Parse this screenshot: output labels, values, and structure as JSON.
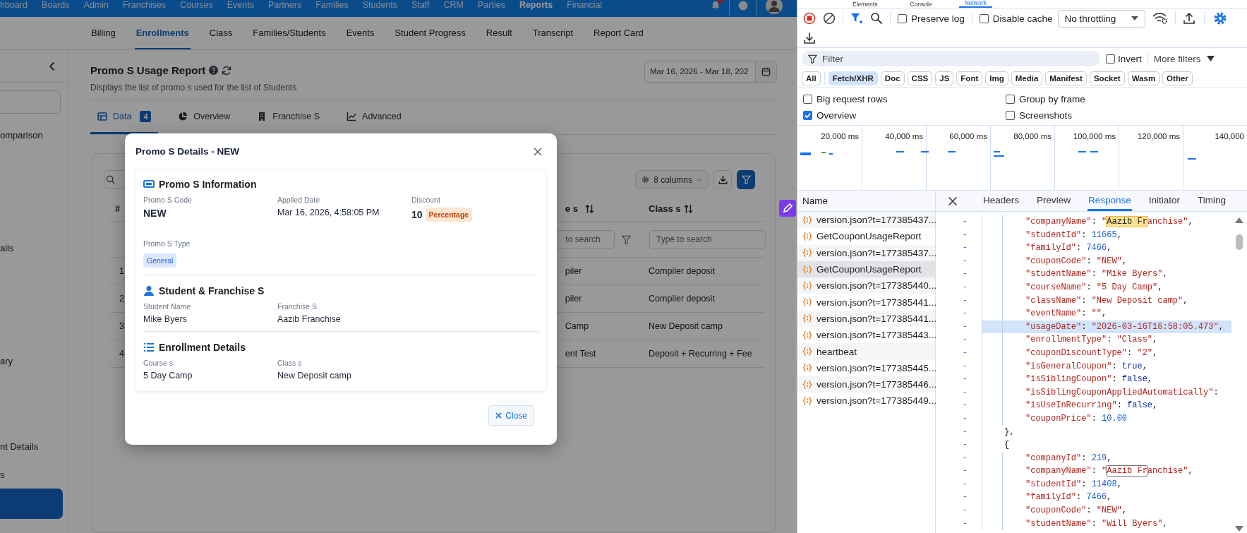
{
  "app": {
    "top_nav": [
      {
        "label": "hboard",
        "selected": false
      },
      {
        "label": "Boards",
        "selected": false
      },
      {
        "label": "Admin",
        "selected": false
      },
      {
        "label": "Franchises",
        "selected": false
      },
      {
        "label": "Courses",
        "selected": false
      },
      {
        "label": "Events",
        "selected": false
      },
      {
        "label": "Partners",
        "selected": false
      },
      {
        "label": "Families",
        "selected": false
      },
      {
        "label": "Students",
        "selected": false
      },
      {
        "label": "Staff",
        "selected": false
      },
      {
        "label": "CRM",
        "selected": false
      },
      {
        "label": "Parties",
        "selected": false
      },
      {
        "label": "Reports",
        "selected": true
      },
      {
        "label": "Financial",
        "selected": false
      }
    ],
    "sub_nav": [
      {
        "label": "Billing",
        "selected": false
      },
      {
        "label": "Enrollments",
        "selected": true
      },
      {
        "label": "Class",
        "selected": false
      },
      {
        "label": "Families/Students",
        "selected": false
      },
      {
        "label": "Events",
        "selected": false
      },
      {
        "label": "Student Progress",
        "selected": false
      },
      {
        "label": "Result",
        "selected": false
      },
      {
        "label": "Transcript",
        "selected": false
      },
      {
        "label": "Report Card",
        "selected": false
      }
    ],
    "sidebar": {
      "items": [
        "omparison",
        "ails",
        "ary",
        "nt Details",
        "s"
      ]
    },
    "report": {
      "title": "Promo S Usage Report",
      "subtitle": "Displays the list of promo s used for the list of Students",
      "date_range": "Mar 16, 2026 - Mar 18, 202",
      "tabs": [
        {
          "label": "Data",
          "badge": "4",
          "selected": true
        },
        {
          "label": "Overview",
          "selected": false
        },
        {
          "label": "Franchise S",
          "selected": false
        },
        {
          "label": "Advanced",
          "selected": false
        }
      ],
      "columns_button": "8 columns",
      "table": {
        "columns": [
          "#",
          "e s",
          "Class s"
        ],
        "filter_placeholders": [
          "to search",
          "Type to search"
        ],
        "rows": [
          [
            "1",
            "piler",
            "Compiler deposit"
          ],
          [
            "2",
            "piler",
            "Compiler deposit"
          ],
          [
            "3",
            "Camp",
            "New Deposit camp"
          ],
          [
            "4",
            "ent Test",
            "Deposit + Recurring + Fee"
          ]
        ]
      }
    }
  },
  "modal": {
    "title": "Promo S Details - NEW",
    "sections": [
      {
        "title": "Promo S Information",
        "rows": [
          [
            {
              "label": "Promo S Code",
              "value": "NEW",
              "kind": "code"
            },
            {
              "label": "Applied Date",
              "value": "Mar 16, 2026, 4:58:05 PM",
              "kind": "text"
            },
            {
              "label": "Discount",
              "value": "10",
              "badge": "Percentage",
              "color": "#fde6d0",
              "kind": "amount"
            }
          ],
          [
            {
              "label": "Promo S Type",
              "badge": "General",
              "color": "#dbe8fd",
              "kind": "badge"
            }
          ]
        ]
      },
      {
        "title": "Student & Franchise S",
        "rows": [
          [
            {
              "label": "Student Name",
              "value": "Mike Byers",
              "kind": "text"
            },
            {
              "label": "Franchise S",
              "value": "Aazib Franchise",
              "kind": "text"
            }
          ]
        ]
      },
      {
        "title": "Enrollment Details",
        "rows": [
          [
            {
              "label": "Course s",
              "value": "5 Day Camp",
              "kind": "text"
            },
            {
              "label": "Class s",
              "value": "New Deposit camp",
              "kind": "text"
            }
          ]
        ]
      }
    ],
    "close_button": "Close"
  },
  "devtools": {
    "panel_tabs": [
      {
        "label": "Elements",
        "selected": false
      },
      {
        "label": "Console",
        "selected": false
      },
      {
        "label": "Network",
        "selected": true
      }
    ],
    "preserve_log": {
      "label": "Preserve log",
      "checked": false
    },
    "disable_cache": {
      "label": "Disable cache",
      "checked": false
    },
    "throttling": "No throttling",
    "filter": {
      "placeholder": "Filter"
    },
    "invert": {
      "label": "Invert",
      "checked": false
    },
    "more_filters": "More filters",
    "type_filters": [
      {
        "label": "All",
        "selected": false
      },
      {
        "label": "Fetch/XHR",
        "selected": true
      },
      {
        "label": "Doc",
        "selected": false
      },
      {
        "label": "CSS",
        "selected": false
      },
      {
        "label": "JS",
        "selected": false
      },
      {
        "label": "Font",
        "selected": false
      },
      {
        "label": "Img",
        "selected": false
      },
      {
        "label": "Media",
        "selected": false
      },
      {
        "label": "Manifest",
        "selected": false
      },
      {
        "label": "Socket",
        "selected": false
      },
      {
        "label": "Wasm",
        "selected": false
      },
      {
        "label": "Other",
        "selected": false
      }
    ],
    "options": [
      {
        "label": "Big request rows",
        "checked": false
      },
      {
        "label": "Group by frame",
        "checked": false
      },
      {
        "label": "Overview",
        "checked": true
      },
      {
        "label": "Screenshots",
        "checked": false
      }
    ],
    "timeline_ticks": [
      "20,000 ms",
      "40,000 ms",
      "60,000 ms",
      "80,000 ms",
      "100,000 ms",
      "120,000 ms",
      "140,000"
    ],
    "requests": {
      "column": "Name",
      "items": [
        {
          "label": "version.json?t=177385437...",
          "selected": false
        },
        {
          "label": "GetCouponUsageReport",
          "selected": false
        },
        {
          "label": "version.json?t=177385437...",
          "selected": false
        },
        {
          "label": "GetCouponUsageReport",
          "selected": true
        },
        {
          "label": "version.json?t=177385440...",
          "selected": false
        },
        {
          "label": "version.json?t=177385441...",
          "selected": false
        },
        {
          "label": "version.json?t=177385441...",
          "selected": false
        },
        {
          "label": "version.json?t=177385443...",
          "selected": false
        },
        {
          "label": "heartbeat",
          "selected": false
        },
        {
          "label": "version.json?t=177385445...",
          "selected": false
        },
        {
          "label": "version.json?t=177385446...",
          "selected": false
        },
        {
          "label": "version.json?t=177385449...",
          "selected": false
        }
      ]
    },
    "detail_tabs": [
      {
        "label": "Headers",
        "selected": false
      },
      {
        "label": "Preview",
        "selected": false
      },
      {
        "label": "Response",
        "selected": true
      },
      {
        "label": "Initiator",
        "selected": false
      },
      {
        "label": "Timing",
        "selected": false
      }
    ],
    "response_lines": [
      {
        "marker": "-",
        "kind": "pair",
        "highlighted": false,
        "parts": [
          {
            "text": "\"companyName\"",
            "kind": "key"
          },
          {
            "text": ": ",
            "kind": "punct"
          },
          {
            "text": "\"",
            "kind": "str"
          },
          {
            "text": "Aazib Fr",
            "kind": "match-current"
          },
          {
            "text": "anchise\"",
            "kind": "str"
          },
          {
            "text": ",",
            "kind": "punct"
          }
        ]
      },
      {
        "marker": "-",
        "kind": "pair",
        "highlighted": false,
        "parts": [
          {
            "text": "\"studentId\"",
            "kind": "key"
          },
          {
            "text": ": ",
            "kind": "punct"
          },
          {
            "text": "11665",
            "kind": "num"
          },
          {
            "text": ",",
            "kind": "punct"
          }
        ]
      },
      {
        "marker": "-",
        "kind": "pair",
        "highlighted": false,
        "parts": [
          {
            "text": "\"familyId\"",
            "kind": "key"
          },
          {
            "text": ": ",
            "kind": "punct"
          },
          {
            "text": "7466",
            "kind": "num"
          },
          {
            "text": ",",
            "kind": "punct"
          }
        ]
      },
      {
        "marker": "-",
        "kind": "pair",
        "highlighted": false,
        "parts": [
          {
            "text": "\"couponCode\"",
            "kind": "key"
          },
          {
            "text": ": ",
            "kind": "punct"
          },
          {
            "text": "\"NEW\"",
            "kind": "str"
          },
          {
            "text": ",",
            "kind": "punct"
          }
        ]
      },
      {
        "marker": "-",
        "kind": "pair",
        "highlighted": false,
        "parts": [
          {
            "text": "\"studentName\"",
            "kind": "key"
          },
          {
            "text": ": ",
            "kind": "punct"
          },
          {
            "text": "\"Mike Byers\"",
            "kind": "str"
          },
          {
            "text": ",",
            "kind": "punct"
          }
        ]
      },
      {
        "marker": "-",
        "kind": "pair",
        "highlighted": false,
        "parts": [
          {
            "text": "\"courseName\"",
            "kind": "key"
          },
          {
            "text": ": ",
            "kind": "punct"
          },
          {
            "text": "\"5 Day Camp\"",
            "kind": "str"
          },
          {
            "text": ",",
            "kind": "punct"
          }
        ]
      },
      {
        "marker": "-",
        "kind": "pair",
        "highlighted": false,
        "parts": [
          {
            "text": "\"className\"",
            "kind": "key"
          },
          {
            "text": ": ",
            "kind": "punct"
          },
          {
            "text": "\"New Deposit camp\"",
            "kind": "str"
          },
          {
            "text": ",",
            "kind": "punct"
          }
        ]
      },
      {
        "marker": "-",
        "kind": "pair",
        "highlighted": false,
        "parts": [
          {
            "text": "\"eventName\"",
            "kind": "key"
          },
          {
            "text": ": ",
            "kind": "punct"
          },
          {
            "text": "\"\"",
            "kind": "str"
          },
          {
            "text": ",",
            "kind": "punct"
          }
        ]
      },
      {
        "marker": "-",
        "kind": "pair",
        "highlighted": true,
        "parts": [
          {
            "text": "\"usageDate\"",
            "kind": "key"
          },
          {
            "text": ": ",
            "kind": "punct"
          },
          {
            "text": "\"2026-03-16T16:58:05.473\"",
            "kind": "str"
          },
          {
            "text": ",",
            "kind": "punct"
          }
        ]
      },
      {
        "marker": "-",
        "kind": "pair",
        "highlighted": false,
        "parts": [
          {
            "text": "\"enrollmentType\"",
            "kind": "key"
          },
          {
            "text": ": ",
            "kind": "punct"
          },
          {
            "text": "\"Class\"",
            "kind": "str"
          },
          {
            "text": ",",
            "kind": "punct"
          }
        ]
      },
      {
        "marker": "-",
        "kind": "pair",
        "highlighted": false,
        "parts": [
          {
            "text": "\"couponDiscountType\"",
            "kind": "key"
          },
          {
            "text": ": ",
            "kind": "punct"
          },
          {
            "text": "\"2\"",
            "kind": "str"
          },
          {
            "text": ",",
            "kind": "punct"
          }
        ]
      },
      {
        "marker": "-",
        "kind": "pair",
        "highlighted": false,
        "parts": [
          {
            "text": "\"isGeneralCoupon\"",
            "kind": "key"
          },
          {
            "text": ": ",
            "kind": "punct"
          },
          {
            "text": "true",
            "kind": "lit"
          },
          {
            "text": ",",
            "kind": "punct"
          }
        ]
      },
      {
        "marker": "-",
        "kind": "pair",
        "highlighted": false,
        "parts": [
          {
            "text": "\"isSiblingCoupon\"",
            "kind": "key"
          },
          {
            "text": ": ",
            "kind": "punct"
          },
          {
            "text": "false",
            "kind": "lit"
          },
          {
            "text": ",",
            "kind": "punct"
          }
        ]
      },
      {
        "marker": "-",
        "kind": "pair",
        "highlighted": false,
        "parts": [
          {
            "text": "\"isSiblingCouponAppliedAutomatically\"",
            "kind": "key"
          },
          {
            "text": ":",
            "kind": "punct"
          }
        ]
      },
      {
        "marker": "-",
        "kind": "pair",
        "highlighted": false,
        "parts": [
          {
            "text": "\"isUseInRecurring\"",
            "kind": "key"
          },
          {
            "text": ": ",
            "kind": "punct"
          },
          {
            "text": "false",
            "kind": "lit"
          },
          {
            "text": ",",
            "kind": "punct"
          }
        ]
      },
      {
        "marker": "-",
        "kind": "pair",
        "highlighted": false,
        "parts": [
          {
            "text": "\"couponPrice\"",
            "kind": "key"
          },
          {
            "text": ": ",
            "kind": "punct"
          },
          {
            "text": "10.00",
            "kind": "num"
          }
        ]
      },
      {
        "marker": "-",
        "kind": "brace",
        "highlighted": false,
        "parts": [
          {
            "text": "},",
            "kind": "punct"
          }
        ]
      },
      {
        "marker": "-",
        "kind": "brace",
        "highlighted": false,
        "parts": [
          {
            "text": "{",
            "kind": "punct"
          }
        ]
      },
      {
        "marker": "-",
        "kind": "pair",
        "highlighted": false,
        "parts": [
          {
            "text": "\"companyId\"",
            "kind": "key"
          },
          {
            "text": ": ",
            "kind": "punct"
          },
          {
            "text": "219",
            "kind": "num"
          },
          {
            "text": ",",
            "kind": "punct"
          }
        ]
      },
      {
        "marker": "-",
        "kind": "pair",
        "highlighted": false,
        "parts": [
          {
            "text": "\"companyName\"",
            "kind": "key"
          },
          {
            "text": ": ",
            "kind": "punct"
          },
          {
            "text": "\"",
            "kind": "str"
          },
          {
            "text": "Aazib Fr",
            "kind": "match"
          },
          {
            "text": "anchise\"",
            "kind": "str"
          },
          {
            "text": ",",
            "kind": "punct"
          }
        ]
      },
      {
        "marker": "-",
        "kind": "pair",
        "highlighted": false,
        "parts": [
          {
            "text": "\"studentId\"",
            "kind": "key"
          },
          {
            "text": ": ",
            "kind": "punct"
          },
          {
            "text": "11408",
            "kind": "num"
          },
          {
            "text": ",",
            "kind": "punct"
          }
        ]
      },
      {
        "marker": "-",
        "kind": "pair",
        "highlighted": false,
        "parts": [
          {
            "text": "\"familyId\"",
            "kind": "key"
          },
          {
            "text": ": ",
            "kind": "punct"
          },
          {
            "text": "7466",
            "kind": "num"
          },
          {
            "text": ",",
            "kind": "punct"
          }
        ]
      },
      {
        "marker": "-",
        "kind": "pair",
        "highlighted": false,
        "parts": [
          {
            "text": "\"couponCode\"",
            "kind": "key"
          },
          {
            "text": ": ",
            "kind": "punct"
          },
          {
            "text": "\"NEW\"",
            "kind": "str"
          },
          {
            "text": ",",
            "kind": "punct"
          }
        ]
      },
      {
        "marker": "-",
        "kind": "pair",
        "highlighted": false,
        "parts": [
          {
            "text": "\"studentName\"",
            "kind": "key"
          },
          {
            "text": ": ",
            "kind": "punct"
          },
          {
            "text": "\"Will Byers\"",
            "kind": "str"
          },
          {
            "text": ",",
            "kind": "punct"
          }
        ]
      }
    ]
  }
}
